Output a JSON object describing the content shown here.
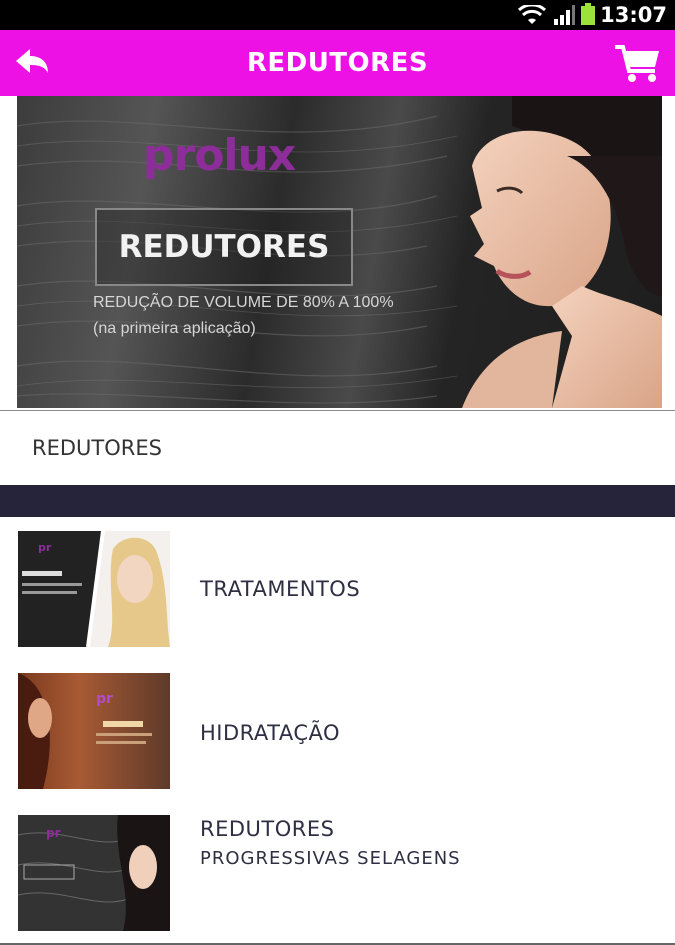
{
  "status_bar": {
    "time": "13:07",
    "icons": [
      "wifi-icon",
      "signal-icon",
      "battery-icon"
    ]
  },
  "app_bar": {
    "title": "REDUTORES",
    "color": "#ee11e6",
    "back_icon": "back-arrow-icon",
    "cart_icon": "cart-icon"
  },
  "banner": {
    "brand": "prolux",
    "title": "REDUTORES",
    "line1": "REDUÇÃO DE VOLUME DE 80% A 100%",
    "line2": "(na primeira aplicação)"
  },
  "category": {
    "title": "REDUTORES"
  },
  "items": [
    {
      "label": "TRATAMENTOS",
      "subtitle": ""
    },
    {
      "label": "HIDRATAÇÃO",
      "subtitle": ""
    },
    {
      "label": "REDUTORES",
      "subtitle": "PROGRESSIVAS SELAGENS"
    }
  ]
}
